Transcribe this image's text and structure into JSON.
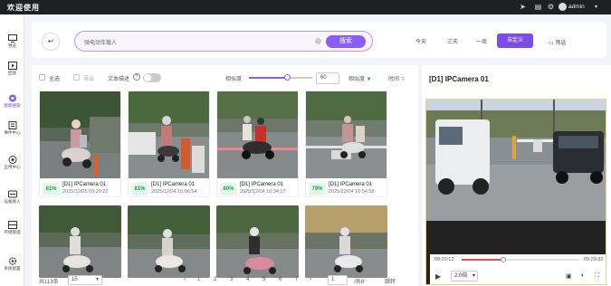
{
  "app": {
    "title": "欢迎使用",
    "user": "admin"
  },
  "topbar": {
    "icons": [
      "send-icon",
      "document-icon",
      "settings-icon",
      "bell-icon"
    ]
  },
  "sidebar": {
    "items": [
      {
        "label": "预览",
        "icon": "monitor-icon"
      },
      {
        "label": "回放",
        "icon": "play-icon"
      },
      {
        "label": "智能搜索",
        "icon": "ai-search-icon",
        "active": true
      },
      {
        "label": "事件中心",
        "icon": "event-icon"
      },
      {
        "label": "应用中心",
        "icon": "app-icon"
      },
      {
        "label": "设备接入",
        "icon": "device-icon"
      },
      {
        "label": "存储管理",
        "icon": "storage-icon"
      },
      {
        "label": "系统配置",
        "icon": "gear-icon"
      }
    ]
  },
  "search": {
    "placeholder": "骑电动车载人",
    "button": "搜索"
  },
  "time_ranges": [
    "今天",
    "三天",
    "一周"
  ],
  "custom_button": "自定义",
  "filter_button": "筛选",
  "toolbar": {
    "select_all": "全选",
    "export": "导出",
    "text_desc": "文本描述",
    "similarity": "相似度",
    "similarity_value": "60",
    "similarity_level": 0.6,
    "sort_similarity": "相似度",
    "sort_time": "时间"
  },
  "results": [
    {
      "score": "81%",
      "camera": "[D1] IPCamera 01",
      "time": "2025/12/05 09:20:22"
    },
    {
      "score": "81%",
      "camera": "[D1] IPCamera 01",
      "time": "2025/12/04 16:06:54"
    },
    {
      "score": "80%",
      "camera": "[D1] IPCamera 01",
      "time": "2025/12/04 16:34:17"
    },
    {
      "score": "79%",
      "camera": "[D1] IPCamera 01",
      "time": "2025/12/04 16:54:58"
    }
  ],
  "pager": {
    "total": "共113条",
    "page_size": "15",
    "pages": [
      "1",
      "2",
      "3",
      "4",
      "5",
      "6",
      "7"
    ],
    "goto_value": "1",
    "total_pages": "/共8",
    "goto": "跳转"
  },
  "player": {
    "title": "[D1] IPCamera 01",
    "time_start": "09:20:12",
    "time_end": "09:20:32",
    "progress": 0.35,
    "speed": "2.0倍"
  },
  "colors": {
    "accent": "#7c4ee8",
    "score_green": "#1aa051",
    "topbar": "#1f2024"
  }
}
